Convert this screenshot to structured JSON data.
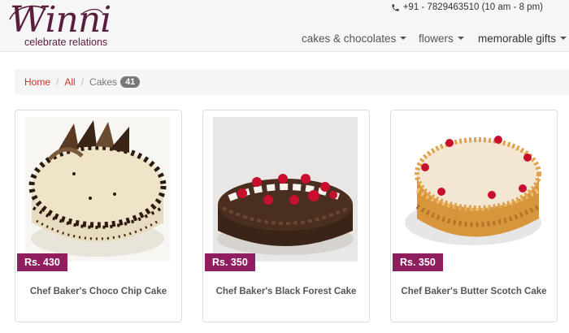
{
  "brand": {
    "logo_text": "Winni",
    "tagline": "celebrate relations",
    "color": "#5a1d3e"
  },
  "header": {
    "phone_icon": "phone-icon",
    "contact": "+91 - 7829463510 (10 am - 8 pm)"
  },
  "nav": {
    "items": [
      {
        "label": "cakes & chocolates",
        "has_caret": true
      },
      {
        "label": "flowers",
        "has_caret": true
      },
      {
        "label": "memorable gifts",
        "has_caret": true
      }
    ]
  },
  "breadcrumb": {
    "items": [
      "Home",
      "All"
    ],
    "current": "Cakes",
    "count": "41",
    "link_color": "#c0392b"
  },
  "products": [
    {
      "price": "Rs.  430",
      "name": "Chef Baker's Choco Chip Cake",
      "image": "choco-chip-cake"
    },
    {
      "price": "Rs.  350",
      "name": "Chef Baker's Black Forest Cake",
      "image": "black-forest-cake"
    },
    {
      "price": "Rs.  350",
      "name": "Chef Baker's Butter Scotch Cake",
      "image": "butter-scotch-cake"
    }
  ],
  "colors": {
    "price_badge": "#8e1e5e",
    "header_bg": "#f6f6f6"
  }
}
